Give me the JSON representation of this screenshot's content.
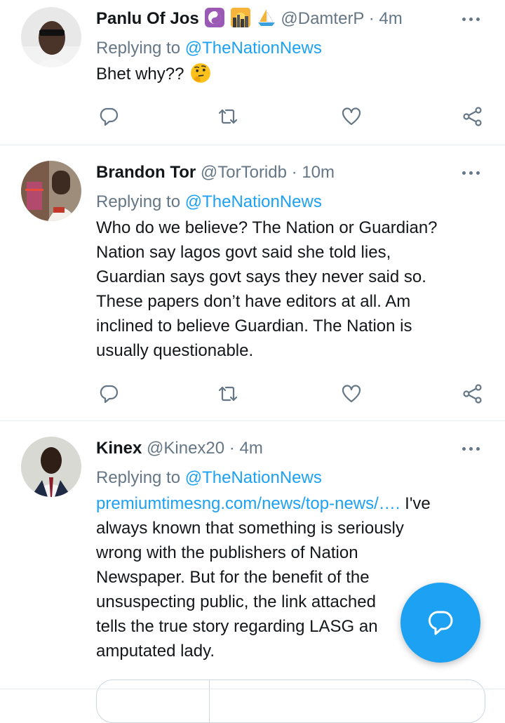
{
  "colors": {
    "accent": "#1da1f2",
    "secondary_text": "#657786",
    "primary_text": "#14171a",
    "divider": "#e6ecf0"
  },
  "tweets": [
    {
      "name": "Panlu Of Jos",
      "emojis": [
        "yin-yang-emoji",
        "sunrise-city-emoji",
        "sailboat-emoji"
      ],
      "handle": "@DamterP",
      "sep": "·",
      "time": "4m",
      "replying_prefix": "Replying to ",
      "replying_to": "@TheNationNews",
      "text": "Bhet why??",
      "text_emoji": "thinking-face-emoji"
    },
    {
      "name": "Brandon Tor",
      "handle": "@TorToridb",
      "sep": "·",
      "time": "10m",
      "replying_prefix": "Replying to ",
      "replying_to": "@TheNationNews",
      "text": "Who do we believe? The Nation or Guardian?\nNation say lagos govt said she told lies,\nGuardian says govt says they never said so.\nThese papers don’t have editors at all. Am\ninclined to believe Guardian. The Nation is\nusually questionable."
    },
    {
      "name": "Kinex",
      "handle": "@Kinex20",
      "sep": "·",
      "time": "4m",
      "replying_prefix": "Replying to ",
      "replying_to": "@TheNationNews",
      "link": "premiumtimesng.com/news/top-news/….",
      "text": " I've\nalways known that something is seriously\nwrong with the publishers of Nation\nNewspaper. But for the benefit of the\nunsuspecting public, the link attached\ntells the true story regarding LASG an\namputated lady."
    }
  ],
  "icons": {
    "reply": "reply-bubble-icon",
    "retweet": "retweet-icon",
    "like": "heart-icon",
    "share": "share-icon",
    "more": "more-dots-icon",
    "compose": "compose-reply-icon"
  }
}
